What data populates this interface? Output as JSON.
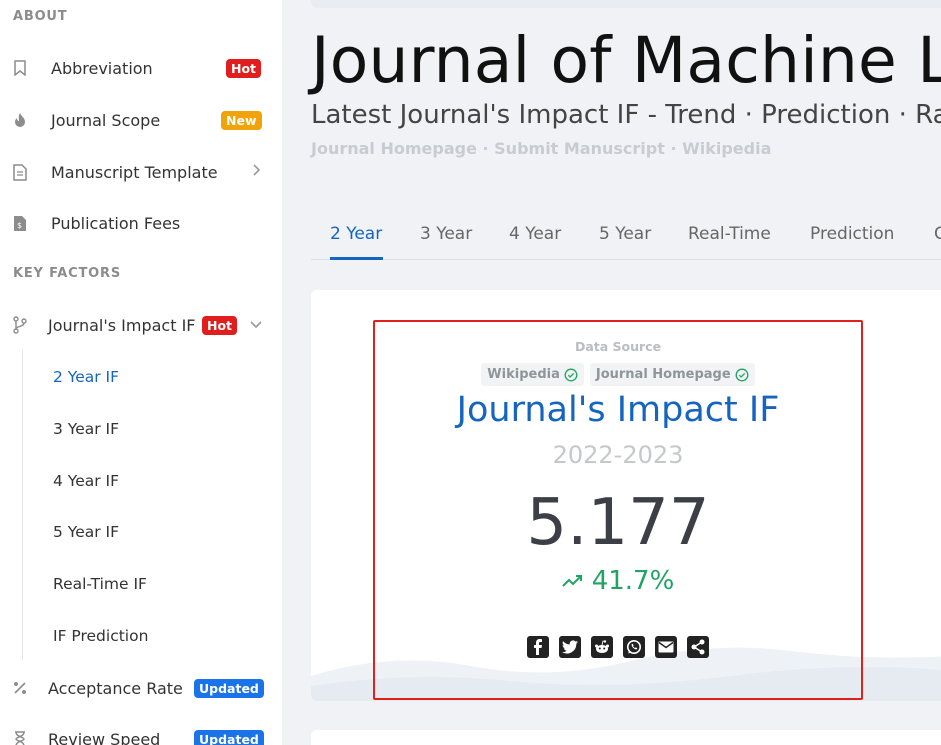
{
  "sidebar": {
    "about_title": "ABOUT",
    "key_factors_title": "KEY FACTORS",
    "items": [
      {
        "label": "Abbreviation",
        "badge": "Hot"
      },
      {
        "label": "Journal Scope",
        "badge": "New"
      },
      {
        "label": "Manuscript Template"
      },
      {
        "label": "Publication Fees"
      }
    ],
    "impact": {
      "label": "Journal's Impact IF",
      "badge": "Hot"
    },
    "sub_items": [
      "2 Year IF",
      "3 Year IF",
      "4 Year IF",
      "5 Year IF",
      "Real-Time IF",
      "IF Prediction"
    ],
    "acceptance": {
      "label": "Acceptance Rate",
      "badge": "Updated"
    },
    "review": {
      "label": "Review Speed",
      "badge": "Updated"
    }
  },
  "main": {
    "title": "Journal of Machine L",
    "subtitle": "Latest Journal's Impact IF - Trend · Prediction · Ra",
    "links": "Journal Homepage · Submit Manuscript · Wikipedia",
    "tabs": [
      "2 Year",
      "3 Year",
      "4 Year",
      "5 Year",
      "Real-Time",
      "Prediction",
      "C"
    ],
    "active_tab": "2 Year"
  },
  "card": {
    "data_source_label": "Data Source",
    "chips": [
      "Wikipedia",
      "Journal Homepage"
    ],
    "title": "Journal's Impact IF",
    "years": "2022-2023",
    "value": "5.177",
    "trend": "41.7%"
  },
  "colors": {
    "accent": "#1565c0",
    "hot": "#e01e1e",
    "new": "#f0a30a",
    "updated": "#1a73e8",
    "trend_up": "#1fa463",
    "highlight": "#e0201c"
  }
}
